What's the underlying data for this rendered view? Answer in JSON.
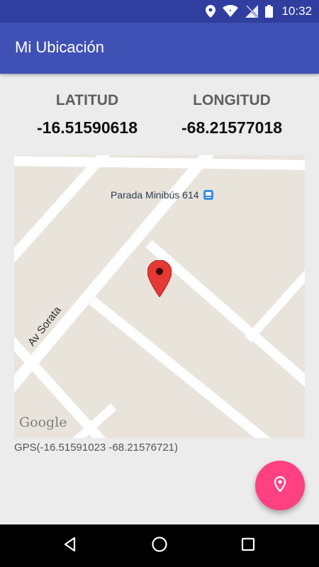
{
  "status_bar": {
    "time": "10:32"
  },
  "app_bar": {
    "title": "Mi Ubicación"
  },
  "coordinates": {
    "latitude_label": "LATITUD",
    "latitude_value": "-16.51590618",
    "longitude_label": "LONGITUD",
    "longitude_value": "-68.21577018"
  },
  "map": {
    "poi_label": "Parada Minibús 614",
    "street_label": "Av Sorata",
    "attribution": "Google"
  },
  "gps_text": "GPS(-16.51591023 -68.21576721)",
  "colors": {
    "status_bar": "#303f9f",
    "app_bar": "#3f51b5",
    "fab": "#ff4081",
    "marker": "#e53935"
  },
  "icons": {
    "fab": "location-pin-icon",
    "nav": [
      "back-icon",
      "home-icon",
      "recents-icon"
    ]
  }
}
